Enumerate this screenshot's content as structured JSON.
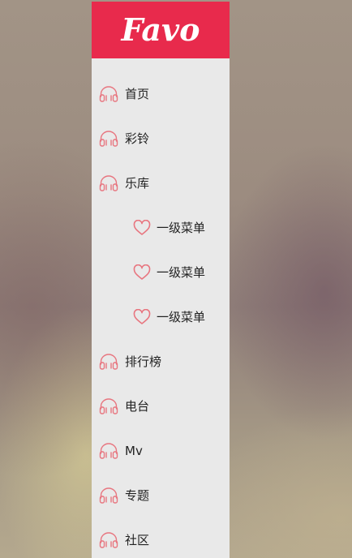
{
  "app": {
    "logo_text": "Favo",
    "brand_color": "#e82a4c",
    "sidebar_bg": "#e9e9e9",
    "icon_color": "#e8757f"
  },
  "menu": {
    "items": [
      {
        "label": "首页",
        "icon": "headphones-icon"
      },
      {
        "label": "彩铃",
        "icon": "headphones-icon"
      },
      {
        "label": "乐库",
        "icon": "headphones-icon"
      },
      {
        "label": "一级菜单",
        "icon": "heart-icon"
      },
      {
        "label": "一级菜单",
        "icon": "heart-icon"
      },
      {
        "label": "一级菜单",
        "icon": "heart-icon"
      },
      {
        "label": "排行榜",
        "icon": "headphones-icon"
      },
      {
        "label": "电台",
        "icon": "headphones-icon"
      },
      {
        "label": "Mv",
        "icon": "headphones-icon"
      },
      {
        "label": "专题",
        "icon": "headphones-icon"
      },
      {
        "label": "社区",
        "icon": "headphones-icon"
      }
    ]
  }
}
